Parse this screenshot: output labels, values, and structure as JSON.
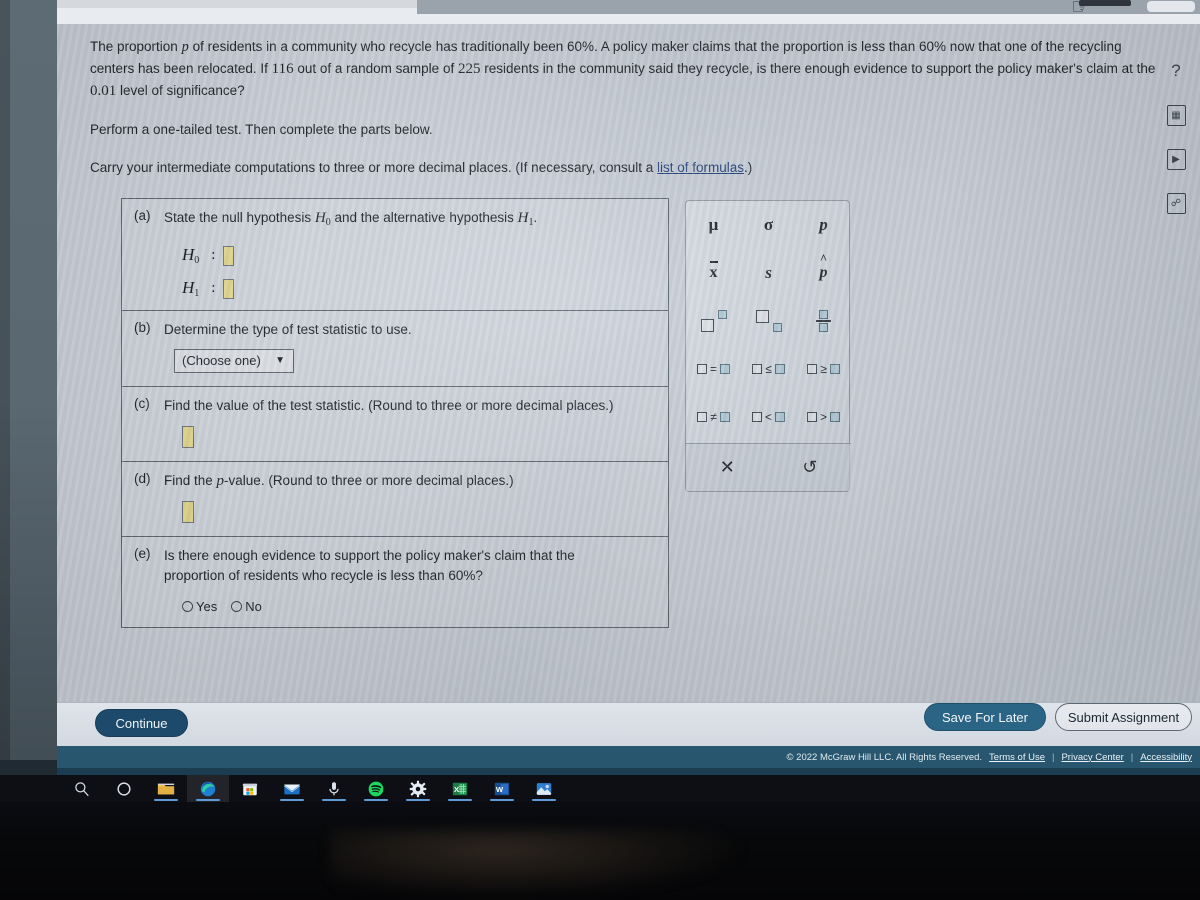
{
  "question": {
    "paragraph_1_parts": [
      "The proportion ",
      "p",
      " of residents in a community who recycle has traditionally been 60%. A policy maker claims that the proportion is less than 60% now that one of the recycling centers has been relocated. If ",
      "116",
      " out of a random sample of ",
      "225",
      " residents in the community said they recycle, is there enough evidence to support the policy maker's claim at the ",
      "0.01",
      " level of significance?"
    ],
    "paragraph_1_a": "The proportion",
    "var_p": "p",
    "paragraph_1_b": "of residents in a community who recycle has traditionally been 60%. A policy maker claims that the proportion is less than 60% now that one of the recycling centers has been relocated. If",
    "n_success": "116",
    "paragraph_1_c": "out of a random sample of",
    "n_total": "225",
    "paragraph_1_d": "residents in the community said they recycle, is there enough evidence to support the policy maker's claim at the",
    "alpha": "0.01",
    "paragraph_1_e": "level of significance?",
    "instruction_perform": "Perform a one-tailed test. Then complete the parts below.",
    "instruction_carry_a": "Carry your intermediate computations to three or more decimal places. (If necessary, consult a",
    "formulas_link": "list of formulas",
    "instruction_carry_b": ".)"
  },
  "parts": {
    "a": {
      "letter": "(a)",
      "text_a": "State the null hypothesis",
      "h0": "H",
      "h0_sub": "0",
      "text_b": "and the alternative hypothesis",
      "h1": "H",
      "h1_sub": "1",
      "text_c": ".",
      "row_h0_label": "H",
      "row_h0_sub": "0",
      "row_h1_label": "H",
      "row_h1_sub": "1",
      "colon": ":",
      "h0_value": "",
      "h1_value": ""
    },
    "b": {
      "letter": "(b)",
      "text": "Determine the type of test statistic to use.",
      "dropdown_value": "(Choose one)",
      "dropdown_caret": "▼"
    },
    "c": {
      "letter": "(c)",
      "text": "Find the value of the test statistic. (Round to three or more decimal places.)",
      "value": ""
    },
    "d": {
      "letter": "(d)",
      "text_a": "Find the",
      "text_p": "p",
      "text_b": "-value. (Round to three or more decimal places.)",
      "value": ""
    },
    "e": {
      "letter": "(e)",
      "text_line1": "Is there enough evidence to support the policy maker's claim that the",
      "text_line2": "proportion of residents who recycle is less than 60%?",
      "option_yes": "Yes",
      "option_no": "No",
      "selected": ""
    }
  },
  "palette": {
    "symbols": [
      {
        "name": "mu",
        "label": "μ"
      },
      {
        "name": "sigma",
        "label": "σ"
      },
      {
        "name": "p",
        "label": "p"
      },
      {
        "name": "x-bar",
        "label": "x"
      },
      {
        "name": "s",
        "label": "s"
      },
      {
        "name": "p-hat",
        "label": "p"
      },
      {
        "name": "superscript",
        "label": ""
      },
      {
        "name": "subscript",
        "label": ""
      },
      {
        "name": "fraction",
        "label": ""
      },
      {
        "name": "equals",
        "label": "="
      },
      {
        "name": "less-than-or-equal",
        "label": "≤"
      },
      {
        "name": "greater-than-or-equal",
        "label": "≥"
      },
      {
        "name": "not-equal",
        "label": "≠"
      },
      {
        "name": "less-than",
        "label": "<"
      },
      {
        "name": "greater-than",
        "label": ">"
      }
    ],
    "clear_label": "✕",
    "undo_label": "↺"
  },
  "actions": {
    "continue_label": "Continue",
    "save_label": "Save For Later",
    "submit_label": "Submit Assignment"
  },
  "footer": {
    "copyright": "© 2022 McGraw Hill LLC. All Rights Reserved.",
    "links": [
      "Terms of Use",
      "Privacy Center",
      "Accessibility"
    ],
    "separator": "|"
  },
  "rail": {
    "items": [
      {
        "name": "help-icon",
        "label": "?"
      },
      {
        "name": "calculator-icon",
        "label": "▦"
      },
      {
        "name": "video-icon",
        "label": "▶"
      },
      {
        "name": "reference-book-icon",
        "label": "⌸"
      }
    ]
  },
  "taskbar": {
    "items": [
      {
        "name": "search-icon",
        "label": "search"
      },
      {
        "name": "cortana-icon",
        "label": "cortana"
      },
      {
        "name": "file-explorer-icon",
        "label": "file-explorer"
      },
      {
        "name": "edge-browser-icon",
        "label": "edge"
      },
      {
        "name": "microsoft-store-icon",
        "label": "store"
      },
      {
        "name": "mail-icon",
        "label": "mail"
      },
      {
        "name": "voice-recorder-icon",
        "label": "recorder"
      },
      {
        "name": "spotify-icon",
        "label": "spotify"
      },
      {
        "name": "settings-gear-icon",
        "label": "settings"
      },
      {
        "name": "excel-icon",
        "label": "X"
      },
      {
        "name": "word-icon",
        "label": "W"
      },
      {
        "name": "photos-icon",
        "label": "photos"
      }
    ]
  },
  "colors": {
    "page_bg": "#c9d0da",
    "accent_blue": "#2a6586",
    "footer_blue": "#28566f",
    "input_yellow": "#e8dc8e",
    "link_blue": "#1f3f7a"
  }
}
